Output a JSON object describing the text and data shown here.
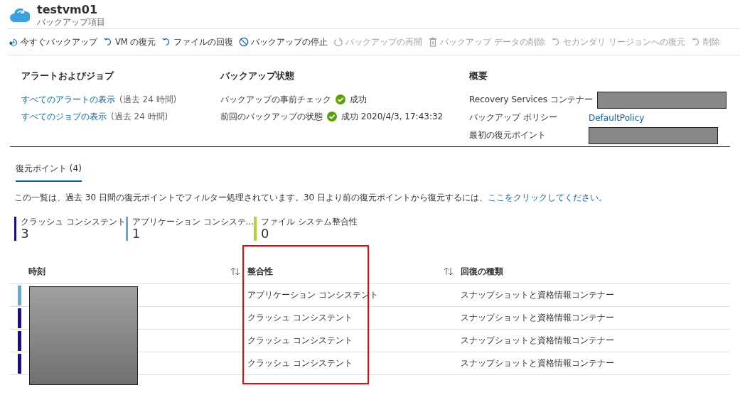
{
  "header": {
    "title": "testvm01",
    "subtitle": "バックアップ項目"
  },
  "toolbar": [
    {
      "label": "今すぐバックアップ",
      "kind": "backup",
      "disabled": false
    },
    {
      "label": "VM の復元",
      "kind": "undo",
      "disabled": false
    },
    {
      "label": "ファイルの回復",
      "kind": "undo",
      "disabled": false
    },
    {
      "label": "バックアップの停止",
      "kind": "stop",
      "disabled": false
    },
    {
      "label": "バックアップの再開",
      "kind": "resume",
      "disabled": true
    },
    {
      "label": "バックアップ データの削除",
      "kind": "trash",
      "disabled": true
    },
    {
      "label": "セカンダリ リージョンへの復元",
      "kind": "undo",
      "disabled": true
    },
    {
      "label": "削除",
      "kind": "undo",
      "disabled": true
    }
  ],
  "summary": [
    {
      "heading": "アラートおよびジョブ",
      "rows": [
        {
          "kind": "link",
          "label": "すべてのアラートの表示",
          "note": "(過去 24 時間)"
        },
        {
          "kind": "link",
          "label": "すべてのジョブの表示",
          "note": "(過去 24 時間)"
        }
      ]
    },
    {
      "heading": "バックアップ状態",
      "rows": [
        {
          "kind": "status",
          "label": "バックアップの事前チェック",
          "value": "成功"
        },
        {
          "kind": "status",
          "label": "前回のバックアップの状態",
          "value": "成功 2020/4/3, 17:43:32"
        }
      ]
    },
    {
      "heading": "概要",
      "rows": [
        {
          "kind": "redacted",
          "label": "Recovery Services コンテナー"
        },
        {
          "kind": "value-link",
          "label": "バックアップ ポリシー",
          "value": "DefaultPolicy"
        },
        {
          "kind": "redacted",
          "label": "最初の復元ポイント"
        }
      ]
    }
  ],
  "tabs": [
    {
      "label": "復元ポイント (4)",
      "selected": true
    }
  ],
  "filter_note": {
    "text": "この一覧は、過去 30 日間の復元ポイントでフィルター処理されています。30 日より前の復元ポイントから復元するには、",
    "link": "ここをクリックしてください。"
  },
  "tiles": [
    {
      "label": "クラッシュ コンシステント",
      "count": "3",
      "color": "#1e0a8c"
    },
    {
      "label": "アプリケーション コンシステ...",
      "count": "1",
      "color": "#60acd8"
    },
    {
      "label": "ファイル システム整合性",
      "count": "0",
      "color": "#b4d335"
    }
  ],
  "table": {
    "time_redacted": true,
    "columns": [
      {
        "label": "時刻",
        "sortable": true,
        "highlighted": false
      },
      {
        "label": "整合性",
        "sortable": true,
        "highlighted": true
      },
      {
        "label": "回復の種類",
        "sortable": false,
        "highlighted": false
      }
    ],
    "rows": [
      {
        "color": "#60acd8",
        "consistency": "アプリケーション コンシステント",
        "recovery_type": "スナップショットと資格情報コンテナー"
      },
      {
        "color": "#1e0a8c",
        "consistency": "クラッシュ コンシステント",
        "recovery_type": "スナップショットと資格情報コンテナー"
      },
      {
        "color": "#1e0a8c",
        "consistency": "クラッシュ コンシステント",
        "recovery_type": "スナップショットと資格情報コンテナー"
      },
      {
        "color": "#1e0a8c",
        "consistency": "クラッシュ コンシステント",
        "recovery_type": "スナップショットと資格情報コンテナー"
      }
    ]
  }
}
